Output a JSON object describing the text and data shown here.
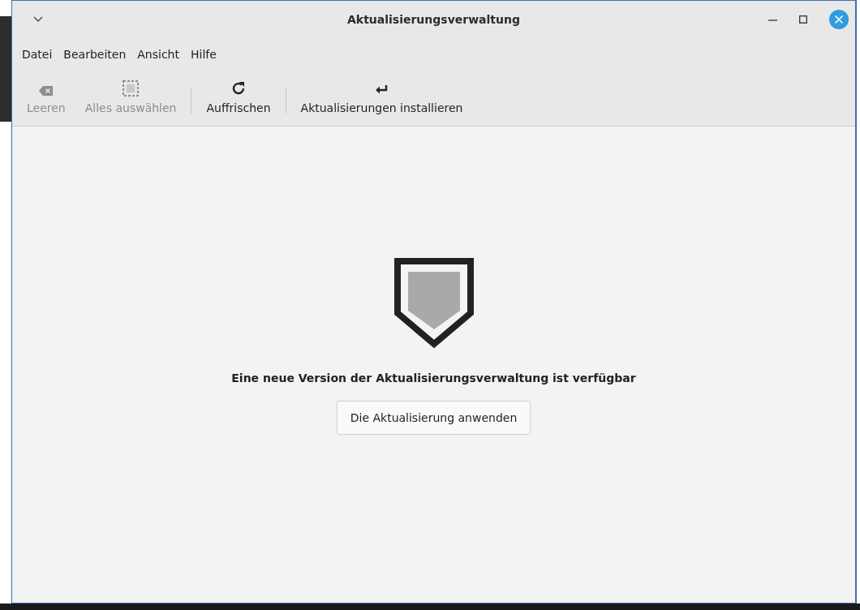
{
  "window": {
    "title": "Aktualisierungsverwaltung"
  },
  "menu": [
    "Datei",
    "Bearbeiten",
    "Ansicht",
    "Hilfe"
  ],
  "toolbar": [
    [
      {
        "kind": "clear",
        "label": "Leeren",
        "disabled": true
      },
      {
        "kind": "select",
        "label": "Alles auswählen",
        "disabled": true
      }
    ],
    [
      {
        "kind": "refresh",
        "label": "Auffrischen",
        "disabled": false
      }
    ],
    [
      {
        "kind": "install",
        "label": "Aktualisierungen installieren",
        "disabled": false
      }
    ]
  ],
  "content": {
    "message": "Eine neue Version der Aktualisierungsverwaltung ist verfügbar",
    "button": "Die Aktualisierung anwenden"
  }
}
